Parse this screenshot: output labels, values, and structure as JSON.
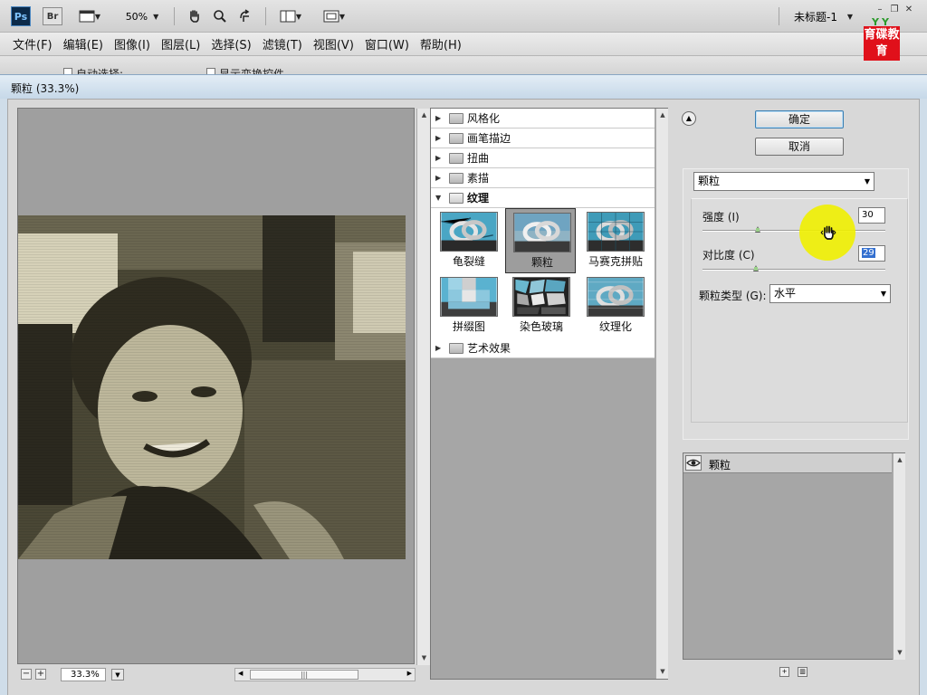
{
  "appbar": {
    "logo": "Ps",
    "bridge": "Br",
    "zoom": "50%",
    "doc_title": "未标题-1",
    "brand_top": "YY",
    "brand_text": "育碟教育",
    "icons": [
      "screen-mode-icon",
      "hand-tool-icon",
      "zoom-tool-icon",
      "rotate-view-icon",
      "arrange-documents-icon",
      "screen-view-icon"
    ]
  },
  "menu": [
    "文件(F)",
    "编辑(E)",
    "图像(I)",
    "图层(L)",
    "选择(S)",
    "滤镜(T)",
    "视图(V)",
    "窗口(W)",
    "帮助(H)"
  ],
  "options": {
    "auto_select": "自动选择:",
    "show_transform": "显示变换控件"
  },
  "dialog": {
    "title": "颗粒 (33.3%)",
    "zoom": "33.3%",
    "categories_before": [
      "风格化",
      "画笔描边",
      "扭曲",
      "素描"
    ],
    "open_category": "纹理",
    "filters": [
      {
        "label": "龟裂缝",
        "selected": false
      },
      {
        "label": "颗粒",
        "selected": true
      },
      {
        "label": "马赛克拼贴",
        "selected": false
      },
      {
        "label": "拼缀图",
        "selected": false
      },
      {
        "label": "染色玻璃",
        "selected": false
      },
      {
        "label": "纹理化",
        "selected": false
      }
    ],
    "categories_after": [
      "艺术效果"
    ],
    "ok": "确定",
    "cancel": "取消",
    "filter_select": "颗粒",
    "intensity_label": "强度 (I)",
    "intensity_value": "30",
    "intensity_level": 0.3,
    "contrast_label": "对比度 (C)",
    "contrast_value": "29",
    "contrast_level": 0.29,
    "grain_type_label": "颗粒类型 (G):",
    "grain_type_value": "水平",
    "layer_name": "颗粒",
    "colors": {
      "accent": "#3470d0",
      "cursor_highlight": "#f0f000",
      "brand_red": "#e0101a"
    }
  }
}
